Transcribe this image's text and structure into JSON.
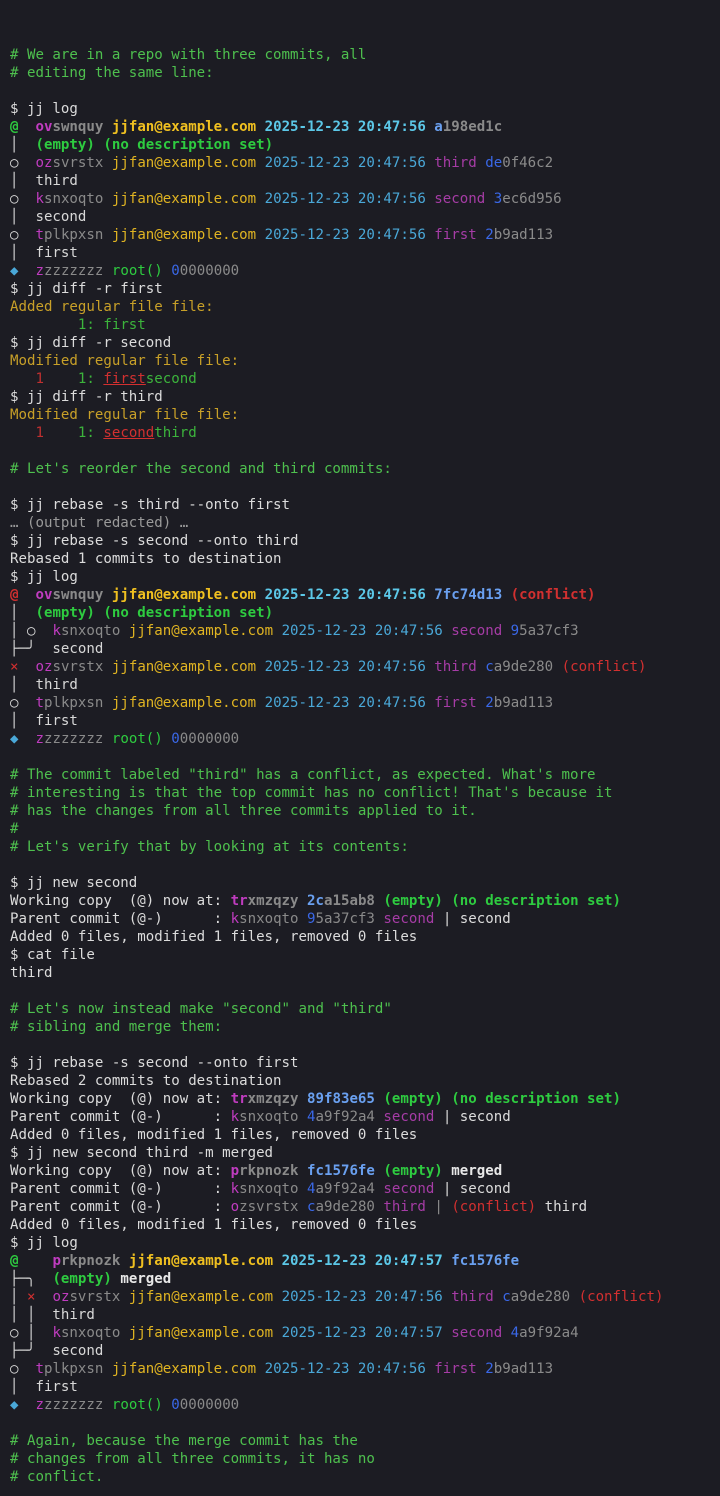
{
  "palette": {
    "default": "#dcdcdc",
    "comment": "#4ec04e",
    "prompt": "#dcdcdc",
    "graph": "#d8d8d8",
    "change_id_prefix": "#c03cc0",
    "change_id_rest": "#8a8a8a",
    "author": "#e0b422",
    "author_wc": "#f0c020",
    "timestamp": "#4aa8d8",
    "timestamp_wc": "#5cc8e8",
    "bookmark": "#a63ca6",
    "commit_id_prefix": "#3a68e8",
    "commit_id_rest": "#8a8a8a",
    "commit_id_wc": "#6aa0f0",
    "empty": "#2ecc40",
    "conflict": "#d23030",
    "removed": "#d23030",
    "added": "#3cb43c",
    "diff_header": "#c8a028",
    "linenum_old": "#c03030",
    "linenum_new": "#3cb43c",
    "dim": "#9a9a9a",
    "wc_bold": "#e8e8e8"
  },
  "lines": [
    [],
    [
      {
        "t": "# We are in a repo with three commits, all",
        "c": "comment"
      }
    ],
    [
      {
        "t": "# editing the same line:",
        "c": "comment"
      }
    ],
    [],
    [
      {
        "t": "$ jj log",
        "c": "prompt"
      }
    ],
    [
      {
        "t": "@  ",
        "c": "empty",
        "b": 1
      },
      {
        "t": "ov",
        "c": "change_id_prefix",
        "b": 1
      },
      {
        "t": "swnquy ",
        "c": "change_id_rest",
        "b": 1
      },
      {
        "t": "jjfan@example.com ",
        "c": "author_wc",
        "b": 1
      },
      {
        "t": "2025-12-23 20:47:56 ",
        "c": "timestamp_wc",
        "b": 1
      },
      {
        "t": "a",
        "c": "commit_id_wc",
        "b": 1
      },
      {
        "t": "198ed1c",
        "c": "commit_id_rest",
        "b": 1
      }
    ],
    [
      {
        "t": "│  ",
        "c": "graph"
      },
      {
        "t": "(empty) (no description set)",
        "c": "empty",
        "b": 1
      }
    ],
    [
      {
        "t": "○  ",
        "c": "graph"
      },
      {
        "t": "oz",
        "c": "change_id_prefix"
      },
      {
        "t": "svrstx ",
        "c": "change_id_rest"
      },
      {
        "t": "jjfan@example.com ",
        "c": "author"
      },
      {
        "t": "2025-12-23 20:47:56 ",
        "c": "timestamp"
      },
      {
        "t": "third ",
        "c": "bookmark"
      },
      {
        "t": "de",
        "c": "commit_id_prefix"
      },
      {
        "t": "0f46c2",
        "c": "commit_id_rest"
      }
    ],
    [
      {
        "t": "│  third",
        "c": "graph"
      }
    ],
    [
      {
        "t": "○  ",
        "c": "graph"
      },
      {
        "t": "k",
        "c": "change_id_prefix"
      },
      {
        "t": "snxoqto ",
        "c": "change_id_rest"
      },
      {
        "t": "jjfan@example.com ",
        "c": "author"
      },
      {
        "t": "2025-12-23 20:47:56 ",
        "c": "timestamp"
      },
      {
        "t": "second ",
        "c": "bookmark"
      },
      {
        "t": "3",
        "c": "commit_id_prefix"
      },
      {
        "t": "ec6d956",
        "c": "commit_id_rest"
      }
    ],
    [
      {
        "t": "│  second",
        "c": "graph"
      }
    ],
    [
      {
        "t": "○  ",
        "c": "graph"
      },
      {
        "t": "t",
        "c": "change_id_prefix"
      },
      {
        "t": "plkpxsn ",
        "c": "change_id_rest"
      },
      {
        "t": "jjfan@example.com ",
        "c": "author"
      },
      {
        "t": "2025-12-23 20:47:56 ",
        "c": "timestamp"
      },
      {
        "t": "first ",
        "c": "bookmark"
      },
      {
        "t": "2",
        "c": "commit_id_prefix"
      },
      {
        "t": "b9ad113",
        "c": "commit_id_rest"
      }
    ],
    [
      {
        "t": "│  first",
        "c": "graph"
      }
    ],
    [
      {
        "t": "◆  ",
        "c": "timestamp"
      },
      {
        "t": "z",
        "c": "change_id_prefix"
      },
      {
        "t": "zzzzzzz ",
        "c": "change_id_rest"
      },
      {
        "t": "root() ",
        "c": "empty"
      },
      {
        "t": "0",
        "c": "commit_id_prefix"
      },
      {
        "t": "0000000",
        "c": "commit_id_rest"
      }
    ],
    [
      {
        "t": "$ jj diff -r first",
        "c": "prompt"
      }
    ],
    [
      {
        "t": "Added regular file file:",
        "c": "diff_header"
      }
    ],
    [
      {
        "t": "        1: ",
        "c": "linenum_new"
      },
      {
        "t": "first",
        "c": "added"
      }
    ],
    [
      {
        "t": "$ jj diff -r second",
        "c": "prompt"
      }
    ],
    [
      {
        "t": "Modified regular file file:",
        "c": "diff_header"
      }
    ],
    [
      {
        "t": "   1",
        "c": "linenum_old"
      },
      {
        "t": "    1: ",
        "c": "linenum_new"
      },
      {
        "t": "first",
        "c": "removed",
        "u": 1
      },
      {
        "t": "second",
        "c": "added"
      }
    ],
    [
      {
        "t": "$ jj diff -r third",
        "c": "prompt"
      }
    ],
    [
      {
        "t": "Modified regular file file:",
        "c": "diff_header"
      }
    ],
    [
      {
        "t": "   1",
        "c": "linenum_old"
      },
      {
        "t": "    1: ",
        "c": "linenum_new"
      },
      {
        "t": "second",
        "c": "removed",
        "u": 1
      },
      {
        "t": "third",
        "c": "added"
      }
    ],
    [],
    [
      {
        "t": "# Let's reorder the second and third commits:",
        "c": "comment"
      }
    ],
    [],
    [
      {
        "t": "$ jj rebase -s third --onto first",
        "c": "prompt"
      }
    ],
    [
      {
        "t": "… (output redacted) …",
        "c": "dim"
      }
    ],
    [
      {
        "t": "$ jj rebase -s second --onto third",
        "c": "prompt"
      }
    ],
    [
      {
        "t": "Rebased 1 commits to destination",
        "c": "default"
      }
    ],
    [
      {
        "t": "$ jj log",
        "c": "prompt"
      }
    ],
    [
      {
        "t": "@  ",
        "c": "conflict",
        "b": 1
      },
      {
        "t": "ov",
        "c": "change_id_prefix",
        "b": 1
      },
      {
        "t": "swnquy ",
        "c": "change_id_rest",
        "b": 1
      },
      {
        "t": "jjfan@example.com ",
        "c": "author_wc",
        "b": 1
      },
      {
        "t": "2025-12-23 20:47:56 ",
        "c": "timestamp_wc",
        "b": 1
      },
      {
        "t": "7fc74d13 ",
        "c": "commit_id_wc",
        "b": 1
      },
      {
        "t": "(conflict)",
        "c": "conflict",
        "b": 1
      }
    ],
    [
      {
        "t": "│  ",
        "c": "graph"
      },
      {
        "t": "(empty) (no description set)",
        "c": "empty",
        "b": 1
      }
    ],
    [
      {
        "t": "│ ○  ",
        "c": "graph"
      },
      {
        "t": "k",
        "c": "change_id_prefix"
      },
      {
        "t": "snxoqto ",
        "c": "change_id_rest"
      },
      {
        "t": "jjfan@example.com ",
        "c": "author"
      },
      {
        "t": "2025-12-23 20:47:56 ",
        "c": "timestamp"
      },
      {
        "t": "second ",
        "c": "bookmark"
      },
      {
        "t": "9",
        "c": "commit_id_prefix"
      },
      {
        "t": "5a37cf3",
        "c": "commit_id_rest"
      }
    ],
    [
      {
        "t": "├─╯  second",
        "c": "graph"
      }
    ],
    [
      {
        "t": "×  ",
        "c": "conflict"
      },
      {
        "t": "oz",
        "c": "change_id_prefix"
      },
      {
        "t": "svrstx ",
        "c": "change_id_rest"
      },
      {
        "t": "jjfan@example.com ",
        "c": "author"
      },
      {
        "t": "2025-12-23 20:47:56 ",
        "c": "timestamp"
      },
      {
        "t": "third ",
        "c": "bookmark"
      },
      {
        "t": "c",
        "c": "commit_id_prefix"
      },
      {
        "t": "a9de280 ",
        "c": "commit_id_rest"
      },
      {
        "t": "(conflict)",
        "c": "conflict"
      }
    ],
    [
      {
        "t": "│  third",
        "c": "graph"
      }
    ],
    [
      {
        "t": "○  ",
        "c": "graph"
      },
      {
        "t": "t",
        "c": "change_id_prefix"
      },
      {
        "t": "plkpxsn ",
        "c": "change_id_rest"
      },
      {
        "t": "jjfan@example.com ",
        "c": "author"
      },
      {
        "t": "2025-12-23 20:47:56 ",
        "c": "timestamp"
      },
      {
        "t": "first ",
        "c": "bookmark"
      },
      {
        "t": "2",
        "c": "commit_id_prefix"
      },
      {
        "t": "b9ad113",
        "c": "commit_id_rest"
      }
    ],
    [
      {
        "t": "│  first",
        "c": "graph"
      }
    ],
    [
      {
        "t": "◆  ",
        "c": "timestamp"
      },
      {
        "t": "z",
        "c": "change_id_prefix"
      },
      {
        "t": "zzzzzzz ",
        "c": "change_id_rest"
      },
      {
        "t": "root() ",
        "c": "empty"
      },
      {
        "t": "0",
        "c": "commit_id_prefix"
      },
      {
        "t": "0000000",
        "c": "commit_id_rest"
      }
    ],
    [],
    [
      {
        "t": "# The commit labeled \"third\" has a conflict, as expected. What's more",
        "c": "comment"
      }
    ],
    [
      {
        "t": "# interesting is that the top commit has no conflict! That's because it",
        "c": "comment"
      }
    ],
    [
      {
        "t": "# has the changes from all three commits applied to it.",
        "c": "comment"
      }
    ],
    [
      {
        "t": "#",
        "c": "comment"
      }
    ],
    [
      {
        "t": "# Let's verify that by looking at its contents:",
        "c": "comment"
      }
    ],
    [],
    [
      {
        "t": "$ jj new second",
        "c": "prompt"
      }
    ],
    [
      {
        "t": "Working copy  (@) now at: ",
        "c": "default"
      },
      {
        "t": "tr",
        "c": "change_id_prefix",
        "b": 1
      },
      {
        "t": "xmzqzy ",
        "c": "change_id_rest",
        "b": 1
      },
      {
        "t": "2c",
        "c": "commit_id_wc",
        "b": 1
      },
      {
        "t": "a15ab8 ",
        "c": "commit_id_rest",
        "b": 1
      },
      {
        "t": "(empty) (no description set)",
        "c": "empty",
        "b": 1
      }
    ],
    [
      {
        "t": "Parent commit (@-)      : ",
        "c": "default"
      },
      {
        "t": "k",
        "c": "change_id_prefix"
      },
      {
        "t": "snxoqto ",
        "c": "change_id_rest"
      },
      {
        "t": "9",
        "c": "commit_id_prefix"
      },
      {
        "t": "5a37cf3 ",
        "c": "commit_id_rest"
      },
      {
        "t": "second",
        "c": "bookmark"
      },
      {
        "t": " | second",
        "c": "default"
      }
    ],
    [
      {
        "t": "Added 0 files, modified 1 files, removed 0 files",
        "c": "default"
      }
    ],
    [
      {
        "t": "$ cat file",
        "c": "prompt"
      }
    ],
    [
      {
        "t": "third",
        "c": "default"
      }
    ],
    [],
    [
      {
        "t": "# Let's now instead make \"second\" and \"third\"",
        "c": "comment"
      }
    ],
    [
      {
        "t": "# sibling and merge them:",
        "c": "comment"
      }
    ],
    [],
    [
      {
        "t": "$ jj rebase -s second --onto first",
        "c": "prompt"
      }
    ],
    [
      {
        "t": "Rebased 2 commits to destination",
        "c": "default"
      }
    ],
    [
      {
        "t": "Working copy  (@) now at: ",
        "c": "default"
      },
      {
        "t": "tr",
        "c": "change_id_prefix",
        "b": 1
      },
      {
        "t": "xmzqzy ",
        "c": "change_id_rest",
        "b": 1
      },
      {
        "t": "89f83e65 ",
        "c": "commit_id_wc",
        "b": 1
      },
      {
        "t": "(empty) (no description set)",
        "c": "empty",
        "b": 1
      }
    ],
    [
      {
        "t": "Parent commit (@-)      : ",
        "c": "default"
      },
      {
        "t": "k",
        "c": "change_id_prefix"
      },
      {
        "t": "snxoqto ",
        "c": "change_id_rest"
      },
      {
        "t": "4",
        "c": "commit_id_prefix"
      },
      {
        "t": "a9f92a4 ",
        "c": "commit_id_rest"
      },
      {
        "t": "second",
        "c": "bookmark"
      },
      {
        "t": " | second",
        "c": "default"
      }
    ],
    [
      {
        "t": "Added 0 files, modified 1 files, removed 0 files",
        "c": "default"
      }
    ],
    [
      {
        "t": "$ jj new second third -m merged",
        "c": "prompt"
      }
    ],
    [
      {
        "t": "Working copy  (@) now at: ",
        "c": "default"
      },
      {
        "t": "p",
        "c": "change_id_prefix",
        "b": 1
      },
      {
        "t": "rkpnozk ",
        "c": "change_id_rest",
        "b": 1
      },
      {
        "t": "fc1576fe ",
        "c": "commit_id_wc",
        "b": 1
      },
      {
        "t": "(empty) ",
        "c": "empty",
        "b": 1
      },
      {
        "t": "merged",
        "c": "wc_bold",
        "b": 1
      }
    ],
    [
      {
        "t": "Parent commit (@-)      : ",
        "c": "default"
      },
      {
        "t": "k",
        "c": "change_id_prefix"
      },
      {
        "t": "snxoqto ",
        "c": "change_id_rest"
      },
      {
        "t": "4",
        "c": "commit_id_prefix"
      },
      {
        "t": "a9f92a4 ",
        "c": "commit_id_rest"
      },
      {
        "t": "second",
        "c": "bookmark"
      },
      {
        "t": " | second",
        "c": "default"
      }
    ],
    [
      {
        "t": "Parent commit (@-)      : ",
        "c": "default"
      },
      {
        "t": "o",
        "c": "change_id_prefix"
      },
      {
        "t": "zsvrstx ",
        "c": "change_id_rest"
      },
      {
        "t": "c",
        "c": "commit_id_prefix"
      },
      {
        "t": "a9de280 ",
        "c": "commit_id_rest"
      },
      {
        "t": "third",
        "c": "bookmark"
      },
      {
        "t": " | ",
        "c": "change_id_rest"
      },
      {
        "t": "(conflict)",
        "c": "conflict"
      },
      {
        "t": " third",
        "c": "default"
      }
    ],
    [
      {
        "t": "Added 0 files, modified 1 files, removed 0 files",
        "c": "default"
      }
    ],
    [
      {
        "t": "$ jj log",
        "c": "prompt"
      }
    ],
    [
      {
        "t": "@    ",
        "c": "empty",
        "b": 1
      },
      {
        "t": "p",
        "c": "change_id_prefix",
        "b": 1
      },
      {
        "t": "rkpnozk ",
        "c": "change_id_rest",
        "b": 1
      },
      {
        "t": "jjfan@example.com ",
        "c": "author_wc",
        "b": 1
      },
      {
        "t": "2025-12-23 20:47:57 ",
        "c": "timestamp_wc",
        "b": 1
      },
      {
        "t": "fc1576fe",
        "c": "commit_id_wc",
        "b": 1
      }
    ],
    [
      {
        "t": "├─╮  ",
        "c": "graph"
      },
      {
        "t": "(empty) ",
        "c": "empty",
        "b": 1
      },
      {
        "t": "merged",
        "c": "wc_bold",
        "b": 1
      }
    ],
    [
      {
        "t": "│ ",
        "c": "graph"
      },
      {
        "t": "×  ",
        "c": "conflict"
      },
      {
        "t": "oz",
        "c": "change_id_prefix"
      },
      {
        "t": "svrstx ",
        "c": "change_id_rest"
      },
      {
        "t": "jjfan@example.com ",
        "c": "author"
      },
      {
        "t": "2025-12-23 20:47:56 ",
        "c": "timestamp"
      },
      {
        "t": "third ",
        "c": "bookmark"
      },
      {
        "t": "c",
        "c": "commit_id_prefix"
      },
      {
        "t": "a9de280 ",
        "c": "commit_id_rest"
      },
      {
        "t": "(conflict)",
        "c": "conflict"
      }
    ],
    [
      {
        "t": "│ │  third",
        "c": "graph"
      }
    ],
    [
      {
        "t": "○ │  ",
        "c": "graph"
      },
      {
        "t": "k",
        "c": "change_id_prefix"
      },
      {
        "t": "snxoqto ",
        "c": "change_id_rest"
      },
      {
        "t": "jjfan@example.com ",
        "c": "author"
      },
      {
        "t": "2025-12-23 20:47:57 ",
        "c": "timestamp"
      },
      {
        "t": "second ",
        "c": "bookmark"
      },
      {
        "t": "4",
        "c": "commit_id_prefix"
      },
      {
        "t": "a9f92a4",
        "c": "commit_id_rest"
      }
    ],
    [
      {
        "t": "├─╯  second",
        "c": "graph"
      }
    ],
    [
      {
        "t": "○  ",
        "c": "graph"
      },
      {
        "t": "t",
        "c": "change_id_prefix"
      },
      {
        "t": "plkpxsn ",
        "c": "change_id_rest"
      },
      {
        "t": "jjfan@example.com ",
        "c": "author"
      },
      {
        "t": "2025-12-23 20:47:56 ",
        "c": "timestamp"
      },
      {
        "t": "first ",
        "c": "bookmark"
      },
      {
        "t": "2",
        "c": "commit_id_prefix"
      },
      {
        "t": "b9ad113",
        "c": "commit_id_rest"
      }
    ],
    [
      {
        "t": "│  first",
        "c": "graph"
      }
    ],
    [
      {
        "t": "◆  ",
        "c": "timestamp"
      },
      {
        "t": "z",
        "c": "change_id_prefix"
      },
      {
        "t": "zzzzzzz ",
        "c": "change_id_rest"
      },
      {
        "t": "root() ",
        "c": "empty"
      },
      {
        "t": "0",
        "c": "commit_id_prefix"
      },
      {
        "t": "0000000",
        "c": "commit_id_rest"
      }
    ],
    [],
    [
      {
        "t": "# Again, because the merge commit has the",
        "c": "comment"
      }
    ],
    [
      {
        "t": "# changes from all three commits, it has no",
        "c": "comment"
      }
    ],
    [
      {
        "t": "# conflict.",
        "c": "comment"
      }
    ]
  ]
}
